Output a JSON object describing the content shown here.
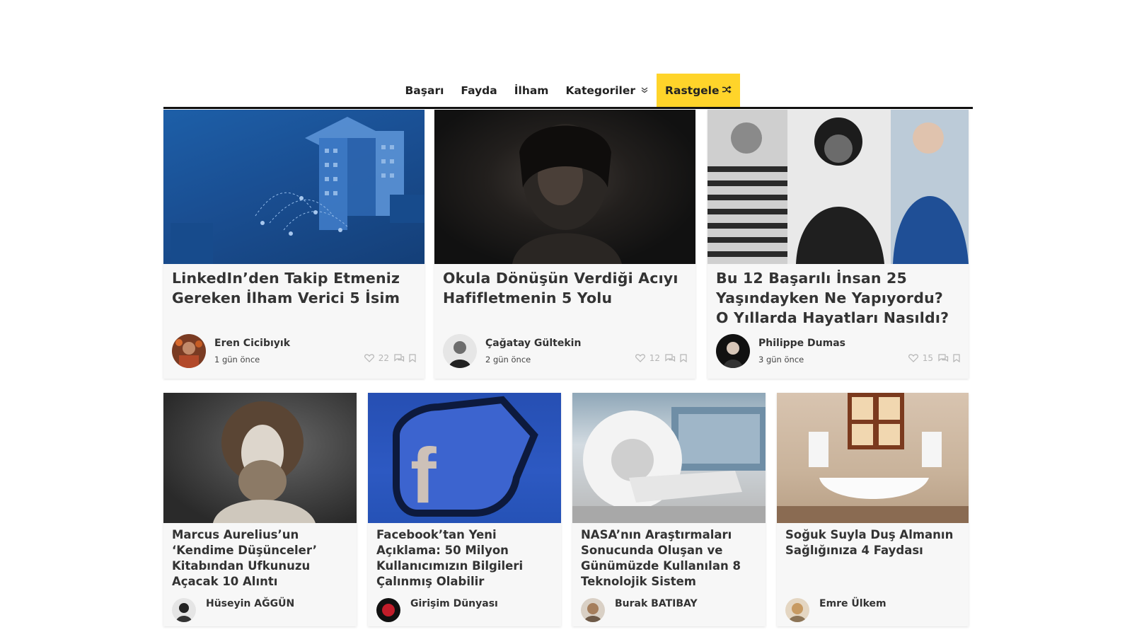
{
  "nav": {
    "items": [
      {
        "label": "Başarı"
      },
      {
        "label": "Fayda"
      },
      {
        "label": "İlham"
      },
      {
        "label": "Kategoriler"
      }
    ],
    "random_label": "Rastgele",
    "accent_color": "#ffd42a"
  },
  "featured": [
    {
      "title": "LinkedIn’den Takip Etmeniz Gereken İlham Verici 5 İsim",
      "author": "Eren Cicibıyık",
      "date": "1 gün önce",
      "likes": "22"
    },
    {
      "title": "Okula Dönüşün Verdiği Acıyı Hafifletmenin 5 Yolu",
      "author": "Çağatay Gültekin",
      "date": "2 gün önce",
      "likes": "12"
    },
    {
      "title": "Bu 12 Başarılı İnsan 25 Yaşındayken Ne Yapıyordu? O Yıllarda Hayatları Nasıldı?",
      "author": "Philippe Dumas",
      "date": "3 gün önce",
      "likes": "15"
    }
  ],
  "posts": [
    {
      "title": "Marcus Aurelius’un ‘Kendime Düşünceler’ Kitabından Ufkunuzu Açacak 10 Alıntı",
      "author": "Hüseyin AĞGÜN"
    },
    {
      "title": "Facebook’tan Yeni Açıklama: 50 Milyon Kullanıcımızın Bilgileri Çalınmış Olabilir",
      "author": "Girişim Dünyası"
    },
    {
      "title": "NASA’nın Araştırmaları Sonucunda Oluşan ve Günümüzde Kullanılan 8 Teknolojik Sistem",
      "author": "Burak BATIBAY"
    },
    {
      "title": "Soğuk Suyla Duş Almanın Sağlığınıza 4 Faydası",
      "author": "Emre Ülkem"
    }
  ]
}
